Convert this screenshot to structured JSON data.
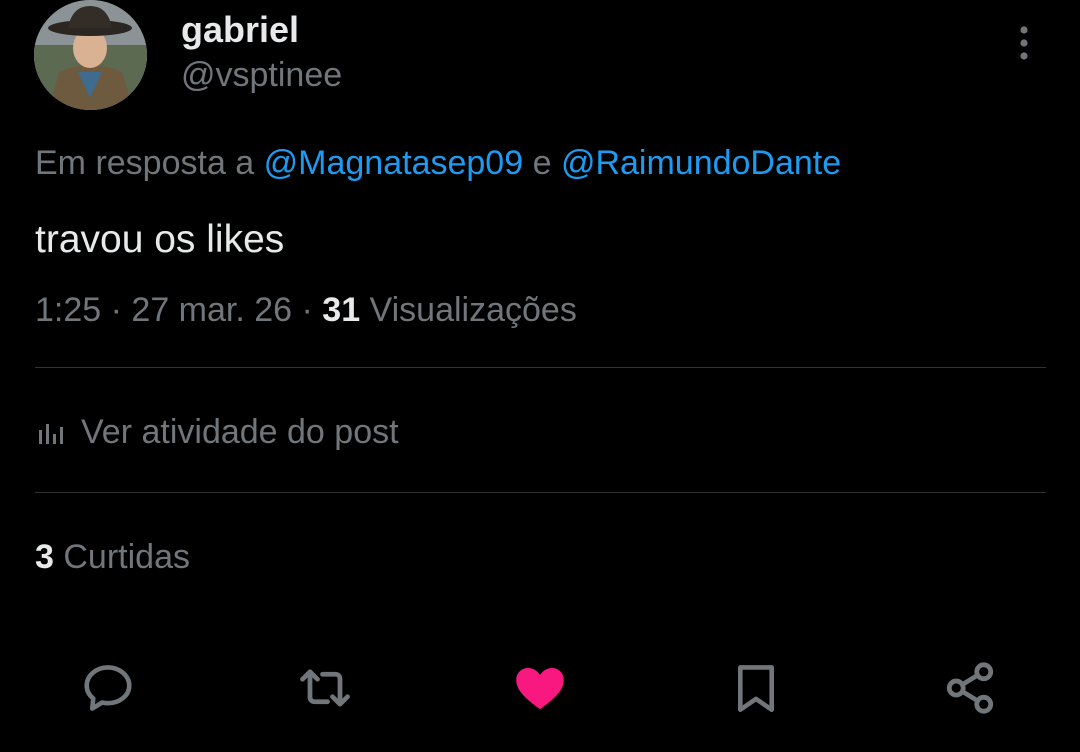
{
  "author": {
    "display_name": "gabriel",
    "handle": "@vsptinee"
  },
  "reply": {
    "prefix": "Em resposta a ",
    "mention_1": "@Magnatasep09",
    "conjunction": " e ",
    "mention_2": "@RaimundoDante"
  },
  "post": {
    "text": "travou os likes",
    "time": "1:25",
    "separator": " · ",
    "date": "27 mar. 26",
    "views_count": "31",
    "views_label": " Visualizações"
  },
  "activity": {
    "label": "Ver atividade do post",
    "icon": "bar-chart-icon"
  },
  "likes": {
    "count": "3",
    "label": " Curtidas"
  },
  "actions": [
    {
      "name": "reply",
      "icon": "speech-bubble-icon"
    },
    {
      "name": "repost",
      "icon": "repost-arrows-icon"
    },
    {
      "name": "like",
      "icon": "heart-filled-icon"
    },
    {
      "name": "bookmark",
      "icon": "bookmark-icon"
    },
    {
      "name": "share",
      "icon": "share-nodes-icon"
    }
  ],
  "colors": {
    "background": "#000000",
    "primary_text": "#e7e9ea",
    "secondary_text": "#71767b",
    "link": "#1d9bf0",
    "like_active": "#f91880",
    "divider": "#2f3336"
  }
}
